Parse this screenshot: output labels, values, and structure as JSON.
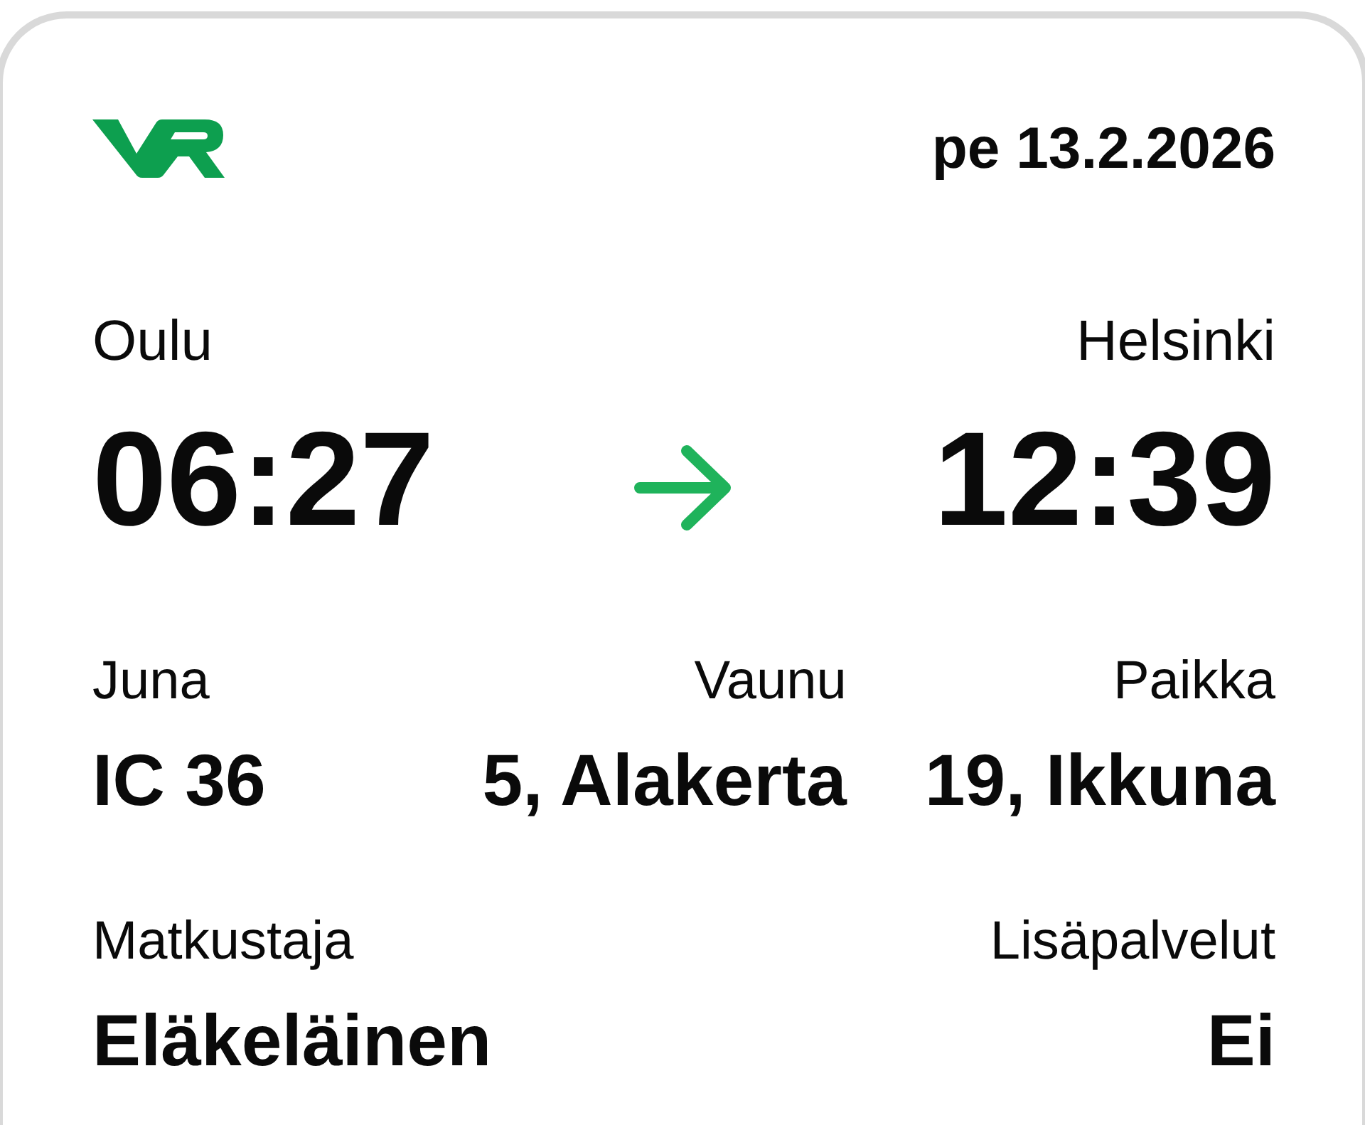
{
  "header": {
    "date": "pe 13.2.2026"
  },
  "route": {
    "origin": {
      "station": "Oulu",
      "time": "06:27"
    },
    "destination": {
      "station": "Helsinki",
      "time": "12:39"
    }
  },
  "details": [
    {
      "label": "Juna",
      "value": "IC 36"
    },
    {
      "label": "Vaunu",
      "value": "5, Alakerta"
    },
    {
      "label": "Paikka",
      "value": "19, Ikkuna"
    }
  ],
  "passenger": [
    {
      "label": "Matkustaja",
      "value": "Eläkeläinen"
    },
    {
      "label": "Lisäpalvelut",
      "value": "Ei"
    }
  ]
}
